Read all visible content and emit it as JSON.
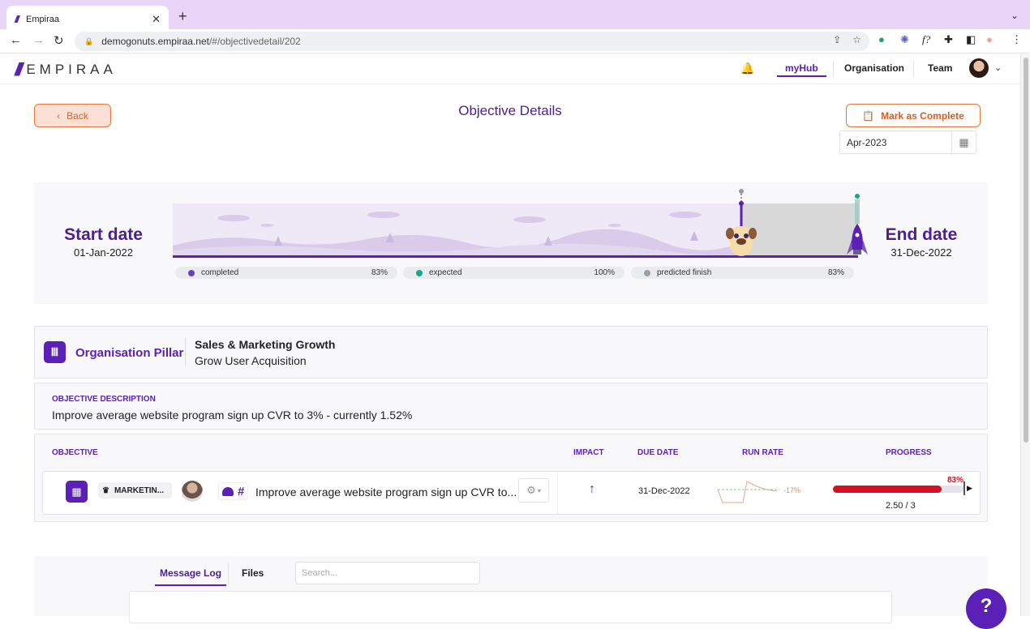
{
  "browser": {
    "tab_title": "Empiraa",
    "url_host": "demogonuts.empiraa.net",
    "url_path": "/#/objectivedetail/202"
  },
  "header": {
    "brand": "EMPIRAA",
    "nav": [
      {
        "label": "myHub",
        "active": true
      },
      {
        "label": "Organisation",
        "active": false
      },
      {
        "label": "Team",
        "active": false
      }
    ]
  },
  "page": {
    "title": "Objective Details",
    "back_label": "Back",
    "complete_label": "Mark as Complete",
    "period_value": "Apr-2023"
  },
  "timeline": {
    "start_label": "Start date",
    "start_date": "01-Jan-2022",
    "end_label": "End date",
    "end_date": "31-Dec-2022",
    "marker_fraction": 0.83,
    "legend": [
      {
        "label": "completed",
        "value": "83%",
        "color": "#6d3fc0"
      },
      {
        "label": "expected",
        "value": "100%",
        "color": "#18a78c"
      },
      {
        "label": "predicted finish",
        "value": "83%",
        "color": "#9aa0a6"
      }
    ]
  },
  "pillar": {
    "label": "Organisation Pillar",
    "title": "Sales & Marketing Growth",
    "subtitle": "Grow User Acquisition"
  },
  "description": {
    "label": "OBJECTIVE DESCRIPTION",
    "text": "Improve average website program sign up CVR to 3% - currently 1.52%"
  },
  "objectives_table": {
    "headers": {
      "objective": "OBJECTIVE",
      "impact": "IMPACT",
      "due_date": "DUE DATE",
      "run_rate": "RUN RATE",
      "progress": "PROGRESS"
    },
    "rows": [
      {
        "team": "MARKETIN...",
        "title": "Improve average website program sign up CVR to...",
        "impact": "up",
        "due_date": "31-Dec-2022",
        "run_rate": "-17%",
        "progress_pct": "83%",
        "progress_fraction": 0.83,
        "progress_value": "2.50 / 3"
      }
    ]
  },
  "bottom": {
    "tabs": [
      {
        "label": "Message Log",
        "active": true
      },
      {
        "label": "Files",
        "active": false
      }
    ],
    "search_placeholder": "Search..."
  },
  "help_label": "?"
}
